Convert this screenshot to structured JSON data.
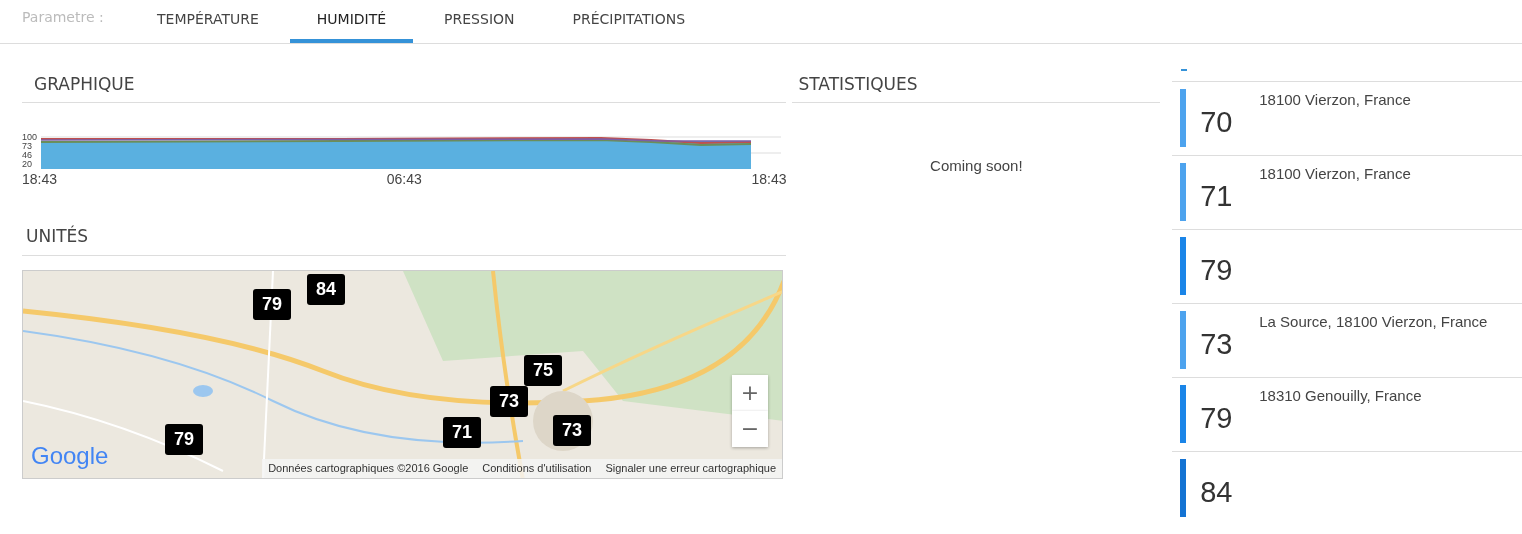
{
  "parameter_label": "Parametre :",
  "tabs": [
    {
      "label": "TEMPÉRATURE",
      "selected": false
    },
    {
      "label": "HUMIDITÉ",
      "selected": true
    },
    {
      "label": "PRESSION",
      "selected": false
    },
    {
      "label": "PRÉCIPITATIONS",
      "selected": false
    }
  ],
  "graph": {
    "title": "GRAPHIQUE",
    "y_labels": [
      "100",
      "73",
      "46",
      "20"
    ],
    "x_labels": [
      "18:43",
      "06:43",
      "18:43"
    ]
  },
  "units": {
    "title": "UNITÉS",
    "map": {
      "kind": "picture",
      "markers": [
        {
          "label": "84"
        },
        {
          "label": "79"
        },
        {
          "label": "79"
        },
        {
          "label": "75"
        },
        {
          "label": "73"
        },
        {
          "label": "73"
        },
        {
          "label": "71"
        }
      ],
      "zoom_in": "+",
      "zoom_out": "−",
      "logo": "Google",
      "attribution": [
        "Données cartographiques ©2016 Google",
        "Conditions d'utilisation",
        "Signaler une erreur cartographique"
      ]
    }
  },
  "statistics": {
    "title": "STATISTIQUES",
    "message": "Coming soon!"
  },
  "readings": [
    {
      "value": "70",
      "location": "18100 Vierzon, France",
      "color": "#4da3ee"
    },
    {
      "value": "71",
      "location": "18100 Vierzon, France",
      "color": "#4da3ee"
    },
    {
      "value": "79",
      "color": "#1a85e8"
    },
    {
      "value": "73",
      "location": "La Source, 18100 Vierzon, France",
      "color": "#4da3ee"
    },
    {
      "value": "79",
      "location": "18310 Genouilly, France",
      "color": "#1a85e8"
    },
    {
      "value": "84",
      "color": "#1473d3"
    }
  ]
}
